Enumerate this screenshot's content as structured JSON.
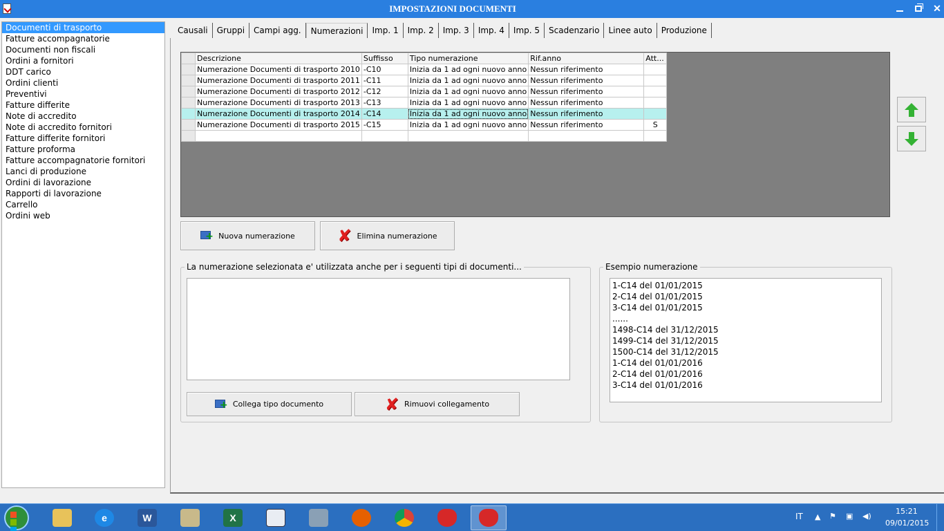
{
  "window": {
    "title": "IMPOSTAZIONI DOCUMENTI"
  },
  "doc_types": [
    "Documenti di trasporto",
    "Fatture accompagnatorie",
    "Documenti non fiscali",
    "Ordini a fornitori",
    "DDT carico",
    "Ordini clienti",
    "Preventivi",
    "Fatture differite",
    "Note di accredito",
    "Note di accredito fornitori",
    "Fatture differite fornitori",
    "Fatture proforma",
    "Fatture accompagnatorie fornitori",
    "Lanci di produzione",
    "Ordini di lavorazione",
    "Rapporti di lavorazione",
    "Carrello",
    "Ordini web"
  ],
  "selected_doc_type": "Documenti di trasporto",
  "tabs": [
    "Causali",
    "Gruppi",
    "Campi agg.",
    "Numerazioni",
    "Imp. 1",
    "Imp. 2",
    "Imp. 3",
    "Imp. 4",
    "Imp. 5",
    "Scadenzario",
    "Linee auto",
    "Produzione"
  ],
  "active_tab": "Numerazioni",
  "grid": {
    "columns": [
      "Descrizione",
      "Suffisso",
      "Tipo numerazione",
      "Rif.anno",
      "Att..."
    ],
    "rows": [
      {
        "descrizione": "Numerazione Documenti di trasporto 2010",
        "suffisso": "-C10",
        "tipo": "Inizia da 1 ad ogni nuovo anno",
        "rif": "Nessun riferimento",
        "att": ""
      },
      {
        "descrizione": "Numerazione Documenti di trasporto 2011",
        "suffisso": "-C11",
        "tipo": "Inizia da 1 ad ogni nuovo anno",
        "rif": "Nessun riferimento",
        "att": ""
      },
      {
        "descrizione": "Numerazione Documenti di trasporto 2012",
        "suffisso": "-C12",
        "tipo": "Inizia da 1 ad ogni nuovo anno",
        "rif": "Nessun riferimento",
        "att": ""
      },
      {
        "descrizione": "Numerazione Documenti di trasporto 2013",
        "suffisso": "-C13",
        "tipo": "Inizia da 1 ad ogni nuovo anno",
        "rif": "Nessun riferimento",
        "att": ""
      },
      {
        "descrizione": "Numerazione Documenti di trasporto 2014",
        "suffisso": "-C14",
        "tipo": "Inizia da 1 ad ogni nuovo anno",
        "rif": "Nessun riferimento",
        "att": ""
      },
      {
        "descrizione": "Numerazione Documenti di trasporto 2015",
        "suffisso": "-C15",
        "tipo": "Inizia da 1 ad ogni nuovo anno",
        "rif": "Nessun riferimento",
        "att": "S"
      }
    ],
    "selected_row": 4
  },
  "buttons": {
    "new_numbering": "Nuova numerazione",
    "delete_numbering": "Elimina numerazione",
    "link_doc_type": "Collega tipo documento",
    "remove_link": "Rimuovi collegamento"
  },
  "linked_group": {
    "label": "La numerazione selezionata e' utilizzata anche per i seguenti tipi di documenti..."
  },
  "example_group": {
    "label": "Esempio numerazione",
    "lines": [
      "1-C14 del 01/01/2015",
      "2-C14 del 01/01/2015",
      "3-C14 del 01/01/2015",
      "......",
      "1498-C14 del 31/12/2015",
      "1499-C14 del 31/12/2015",
      "1500-C14 del 31/12/2015",
      "1-C14 del 01/01/2016",
      "2-C14 del 01/01/2016",
      "3-C14 del 01/01/2016"
    ]
  },
  "taskbar": {
    "apps": [
      "File Explorer",
      "Internet Explorer",
      "Word",
      "Outlook",
      "Excel",
      "Notepad",
      "Scanner",
      "Firefox",
      "Chrome",
      "Strawberry App",
      "Strawberry App (active)"
    ],
    "language": "IT",
    "time": "15:21",
    "date": "09/01/2015"
  },
  "colors": {
    "title_bar": "#2a7fe0",
    "selection": "#3399ff",
    "grid_selected_row": "#b7f0ee",
    "taskbar": "#2b6fc0"
  }
}
